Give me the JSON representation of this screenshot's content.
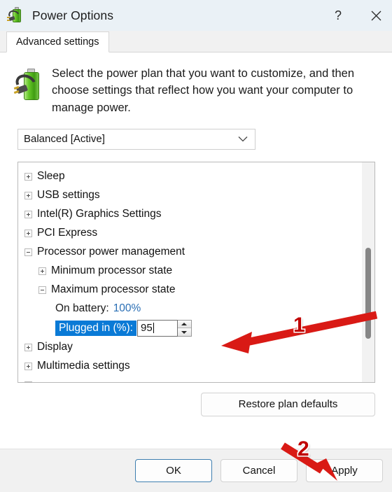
{
  "window": {
    "title": "Power Options",
    "icon": "battery-plug-icon",
    "help_label": "?",
    "close_label": "×"
  },
  "tabs": [
    {
      "label": "Advanced settings",
      "active": true
    }
  ],
  "description": {
    "icon": "battery-plug-large-icon",
    "text": "Select the power plan that you want to customize, and then choose settings that reflect how you want your computer to manage power."
  },
  "plan_select": {
    "value": "Balanced [Active]",
    "chevron": "chevron-down-icon"
  },
  "tree": {
    "items": [
      {
        "label": "Sleep",
        "level": 1,
        "state": "collapsed"
      },
      {
        "label": "USB settings",
        "level": 1,
        "state": "collapsed"
      },
      {
        "label": "Intel(R) Graphics Settings",
        "level": 1,
        "state": "collapsed"
      },
      {
        "label": "PCI Express",
        "level": 1,
        "state": "collapsed"
      },
      {
        "label": "Processor power management",
        "level": 1,
        "state": "expanded"
      },
      {
        "label": "Minimum processor state",
        "level": 2,
        "state": "collapsed"
      },
      {
        "label": "Maximum processor state",
        "level": 2,
        "state": "expanded"
      },
      {
        "label": "On battery:",
        "level": 3,
        "state": "leaf",
        "value": "100%"
      },
      {
        "label": "Plugged in (%):",
        "level": 3,
        "state": "editing",
        "value": "95"
      },
      {
        "label": "Display",
        "level": 1,
        "state": "collapsed"
      },
      {
        "label": "Multimedia settings",
        "level": 1,
        "state": "collapsed"
      }
    ],
    "scrollbar": {
      "name": "vertical-scrollbar",
      "thumb": "scroll-thumb"
    }
  },
  "buttons": {
    "restore": "Restore plan defaults",
    "ok": "OK",
    "cancel": "Cancel",
    "apply": "Apply"
  },
  "annotations": {
    "step1": "1",
    "step2": "2",
    "arrow_color": "#d91a15"
  },
  "colors": {
    "titlebar_bg": "#eaf1f6",
    "selection_blue": "#0a7ad6",
    "link_blue": "#2a6fb5",
    "default_button_border": "#3e7fb0",
    "annotation_red": "#c00000"
  }
}
